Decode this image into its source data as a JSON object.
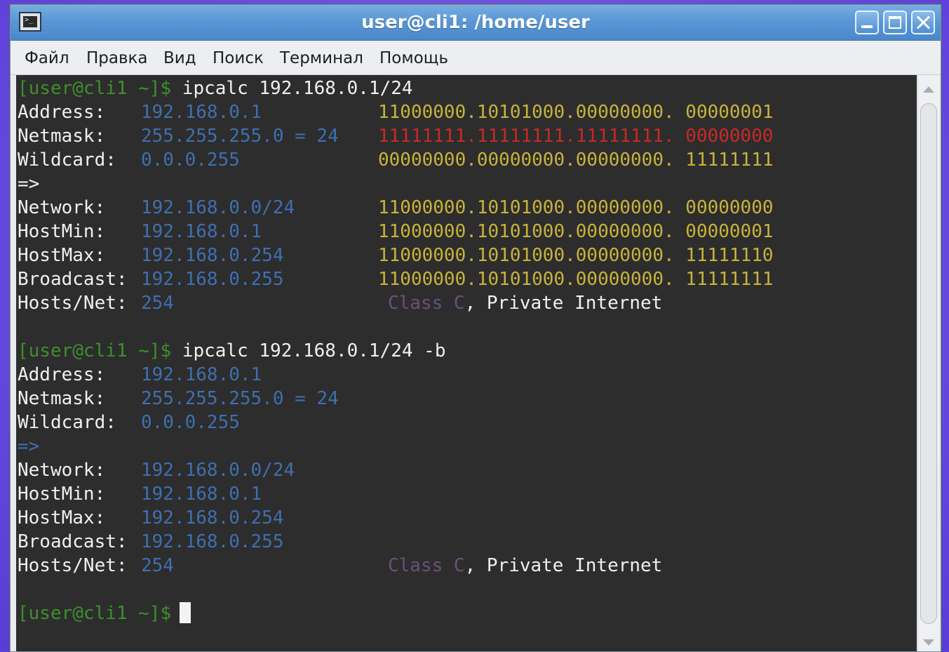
{
  "window": {
    "title": "user@cli1: /home/user"
  },
  "menu": [
    "Файл",
    "Правка",
    "Вид",
    "Поиск",
    "Терминал",
    "Помощь"
  ],
  "terminal": {
    "block1": {
      "prompt": "[user@cli1 ~]$",
      "command": "ipcalc 192.168.0.1/24",
      "rows": [
        {
          "label": "Address:",
          "value": "192.168.0.1",
          "binary": "11000000.10101000.00000000. 00000001"
        },
        {
          "label": "Netmask:",
          "value": "255.255.255.0 = 24",
          "binary": "11111111.11111111.11111111. 00000000"
        },
        {
          "label": "Wildcard:",
          "value": "0.0.0.255",
          "binary": "00000000.00000000.00000000. 11111111"
        },
        {
          "label": "=>",
          "value": "",
          "binary": ""
        },
        {
          "label": "Network:",
          "value": "192.168.0.0/24",
          "binary": "11000000.10101000.00000000. 00000000"
        },
        {
          "label": "HostMin:",
          "value": "192.168.0.1",
          "binary": "11000000.10101000.00000000. 00000001"
        },
        {
          "label": "HostMax:",
          "value": "192.168.0.254",
          "binary": "11000000.10101000.00000000. 11111110"
        },
        {
          "label": "Broadcast:",
          "value": "192.168.0.255",
          "binary": "11000000.10101000.00000000. 11111111"
        },
        {
          "label": "Hosts/Net:",
          "value": "254",
          "class_word": "Class C",
          "class_rest": ", Private Internet"
        }
      ]
    },
    "block2": {
      "prompt": "[user@cli1 ~]$",
      "command": "ipcalc 192.168.0.1/24 -b",
      "rows": [
        {
          "label": "Address:",
          "value": "192.168.0.1"
        },
        {
          "label": "Netmask:",
          "value": "255.255.255.0 = 24"
        },
        {
          "label": "Wildcard:",
          "value": "0.0.0.255"
        },
        {
          "label": "=>",
          "value": ""
        },
        {
          "label": "Network:",
          "value": "192.168.0.0/24"
        },
        {
          "label": "HostMin:",
          "value": "192.168.0.1"
        },
        {
          "label": "HostMax:",
          "value": "192.168.0.254"
        },
        {
          "label": "Broadcast:",
          "value": "192.168.0.255"
        },
        {
          "label": "Hosts/Net:",
          "value": "254",
          "class_word": "Class C",
          "class_rest": ", Private Internet"
        }
      ]
    },
    "final_prompt": "[user@cli1 ~]$"
  },
  "icons": {
    "app": "terminal-app-icon",
    "minimize": "minimize-icon",
    "maximize": "maximize-icon",
    "close": "close-icon",
    "scroll_up": "scroll-up-arrow-icon",
    "scroll_down": "scroll-down-arrow-icon"
  },
  "colors": {
    "terminal_bg": "#2d2d2d",
    "prompt_green": "#3d8f2d",
    "value_blue": "#3f6fb0",
    "binary_yellow": "#c8b33a",
    "netmask_red": "#c62a26",
    "class_purple": "#6b4f7c"
  }
}
